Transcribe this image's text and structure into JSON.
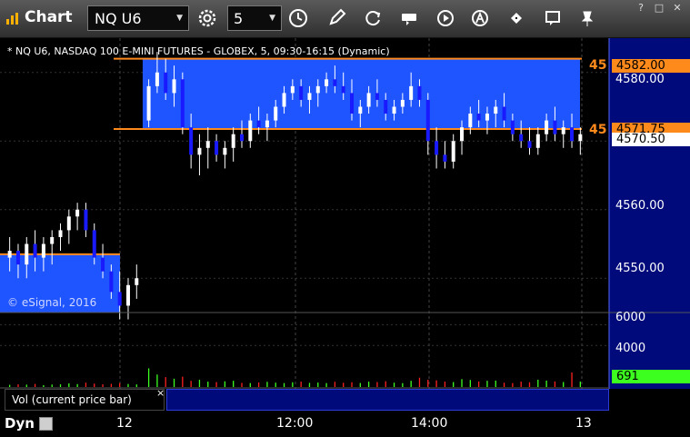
{
  "window": {
    "title": "Chart",
    "symbol": "NQ U6",
    "interval": "5",
    "win_help": "?",
    "win_restore": "□",
    "win_close": "✕"
  },
  "chart": {
    "header": "* NQ U6, NASDAQ 100 E-MINI FUTURES - GLOBEX, 5, 09:30-16:15 (Dynamic)",
    "copyright": "© eSignal, 2016",
    "price_axis": [
      "4580.00",
      "4560.00",
      "4550.00"
    ],
    "tag_upper": "4582.00",
    "tag_lower": "4571.75",
    "tag_last": "4570.50",
    "left_tag_upper": "45",
    "left_tag_lower": "45",
    "volume_axis": [
      "6000",
      "4000"
    ],
    "volume_last": "691",
    "time_axis": [
      "12",
      "12:00",
      "14:00",
      "13"
    ]
  },
  "study": {
    "label": "Vol (current price bar)",
    "close": "×"
  },
  "footer": {
    "mode": "Dyn"
  },
  "colors": {
    "zone_blue": "#1f55ff",
    "level_orange": "#ff8a1c",
    "up_candle": "#ffffff",
    "down_candle": "#1a1aff",
    "axis_panel": "#000a7a",
    "volume_green": "#3cff20"
  },
  "chart_data": {
    "type": "table",
    "ylim": [
      4545,
      4585
    ],
    "levels": [
      4582.0,
      4571.75
    ],
    "last": 4570.5,
    "ohlc": [
      [
        4553,
        4556,
        4551,
        4554
      ],
      [
        4554,
        4555,
        4550,
        4552
      ],
      [
        4552,
        4556,
        4550,
        4555
      ],
      [
        4555,
        4557,
        4551,
        4553
      ],
      [
        4553,
        4556,
        4551,
        4555
      ],
      [
        4555,
        4557,
        4552,
        4556
      ],
      [
        4556,
        4558,
        4554,
        4557
      ],
      [
        4557,
        4560,
        4555,
        4559
      ],
      [
        4559,
        4561,
        4557,
        4560
      ],
      [
        4560,
        4561,
        4556,
        4557
      ],
      [
        4557,
        4558,
        4552,
        4553
      ],
      [
        4553,
        4555,
        4550,
        4551
      ],
      [
        4551,
        4552,
        4547,
        4548
      ],
      [
        4548,
        4551,
        4544,
        4546
      ],
      [
        4546,
        4550,
        4544,
        4549
      ],
      [
        4549,
        4552,
        4547,
        4550
      ],
      [
        4573,
        4579,
        4572,
        4578
      ],
      [
        4578,
        4583,
        4577,
        4580
      ],
      [
        4580,
        4582,
        4576,
        4577
      ],
      [
        4577,
        4581,
        4575,
        4579
      ],
      [
        4579,
        4580,
        4571,
        4572
      ],
      [
        4572,
        4574,
        4566,
        4568
      ],
      [
        4568,
        4571,
        4565,
        4569
      ],
      [
        4569,
        4572,
        4566,
        4570
      ],
      [
        4570,
        4571,
        4567,
        4568
      ],
      [
        4568,
        4570,
        4566,
        4569
      ],
      [
        4569,
        4572,
        4567,
        4571
      ],
      [
        4571,
        4573,
        4569,
        4570
      ],
      [
        4570,
        4574,
        4569,
        4573
      ],
      [
        4573,
        4575,
        4571,
        4572
      ],
      [
        4572,
        4574,
        4570,
        4573
      ],
      [
        4573,
        4576,
        4572,
        4575
      ],
      [
        4575,
        4578,
        4574,
        4577
      ],
      [
        4577,
        4579,
        4576,
        4578
      ],
      [
        4578,
        4579,
        4575,
        4576
      ],
      [
        4576,
        4578,
        4574,
        4577
      ],
      [
        4577,
        4579,
        4575,
        4578
      ],
      [
        4578,
        4580,
        4577,
        4579
      ],
      [
        4579,
        4581,
        4577,
        4578
      ],
      [
        4578,
        4580,
        4576,
        4577
      ],
      [
        4577,
        4579,
        4573,
        4574
      ],
      [
        4574,
        4576,
        4572,
        4575
      ],
      [
        4575,
        4578,
        4574,
        4577
      ],
      [
        4577,
        4579,
        4575,
        4576
      ],
      [
        4576,
        4577,
        4573,
        4574
      ],
      [
        4574,
        4576,
        4573,
        4575
      ],
      [
        4575,
        4577,
        4574,
        4576
      ],
      [
        4576,
        4580,
        4575,
        4578
      ],
      [
        4578,
        4579,
        4575,
        4576
      ],
      [
        4576,
        4577,
        4568,
        4570
      ],
      [
        4570,
        4572,
        4566,
        4568
      ],
      [
        4568,
        4570,
        4566,
        4567
      ],
      [
        4567,
        4571,
        4566,
        4570
      ],
      [
        4570,
        4573,
        4568,
        4572
      ],
      [
        4572,
        4575,
        4571,
        4574
      ],
      [
        4574,
        4576,
        4572,
        4573
      ],
      [
        4573,
        4575,
        4571,
        4574
      ],
      [
        4574,
        4576,
        4572,
        4575
      ],
      [
        4575,
        4577,
        4572,
        4573
      ],
      [
        4573,
        4574,
        4570,
        4571
      ],
      [
        4571,
        4573,
        4569,
        4570
      ],
      [
        4570,
        4572,
        4568,
        4569
      ],
      [
        4569,
        4572,
        4568,
        4571
      ],
      [
        4571,
        4574,
        4570,
        4573
      ],
      [
        4573,
        4575,
        4570,
        4571
      ],
      [
        4571,
        4573,
        4569,
        4572
      ],
      [
        4572,
        4574,
        4569,
        4570
      ],
      [
        4570,
        4572,
        4568,
        4571
      ]
    ],
    "volume": [
      210,
      260,
      230,
      300,
      180,
      240,
      260,
      350,
      280,
      420,
      330,
      260,
      310,
      380,
      290,
      250,
      1800,
      1200,
      950,
      800,
      1000,
      600,
      700,
      520,
      480,
      550,
      600,
      400,
      380,
      440,
      500,
      420,
      380,
      460,
      520,
      400,
      430,
      380,
      500,
      410,
      460,
      390,
      520,
      480,
      560,
      420,
      380,
      600,
      900,
      700,
      640,
      520,
      480,
      760,
      680,
      540,
      600,
      620,
      420,
      380,
      520,
      460,
      700,
      620,
      540,
      480,
      1400,
      520
    ]
  }
}
